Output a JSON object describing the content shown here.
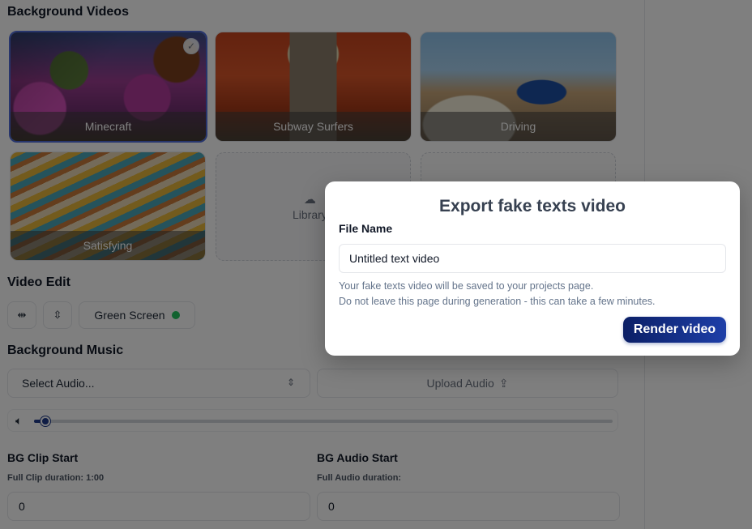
{
  "background_videos": {
    "title": "Background Videos",
    "cards": [
      {
        "label": "Minecraft",
        "selected": true
      },
      {
        "label": "Subway Surfers",
        "selected": false
      },
      {
        "label": "Driving",
        "selected": false
      },
      {
        "label": "Satisfying",
        "selected": false
      }
    ],
    "library": {
      "label": "Library",
      "icon": "cloud-icon"
    }
  },
  "video_edit": {
    "title": "Video Edit",
    "flip_horizontal_icon": "flip-horizontal-icon",
    "flip_vertical_icon": "flip-vertical-icon",
    "green_screen_label": "Green Screen",
    "green_screen_color": "#22c55e"
  },
  "background_music": {
    "title": "Background Music",
    "select_placeholder": "Select Audio...",
    "upload_label": "Upload Audio",
    "volume_percent": 2
  },
  "clip_start": {
    "bg_clip_label": "BG Clip Start",
    "bg_clip_sub": "Full Clip duration: 1:00",
    "bg_clip_value": "0",
    "bg_audio_label": "BG Audio Start",
    "bg_audio_sub": "Full Audio duration:",
    "bg_audio_value": "0"
  },
  "modal": {
    "title": "Export fake texts video",
    "file_name_label": "File Name",
    "file_name_value": "Untitled text video",
    "note_line1": "Your fake texts video will be saved to your projects page.",
    "note_line2": "Do not leave this page during generation - this can take a few minutes.",
    "render_button": "Render video",
    "accent_color": "#1e3a8a"
  }
}
